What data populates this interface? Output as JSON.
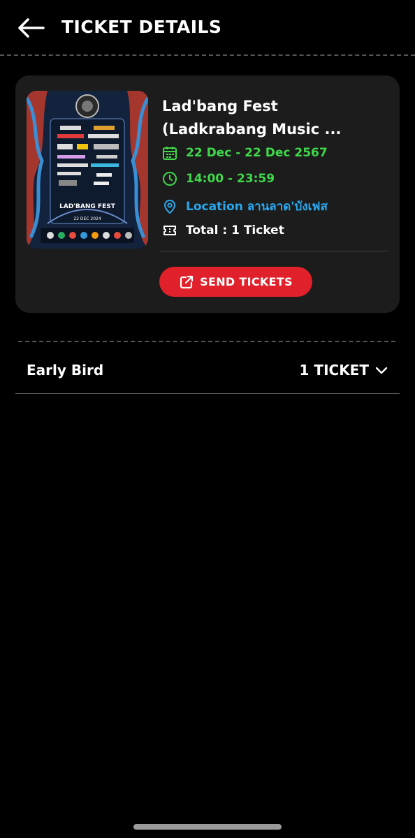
{
  "header": {
    "title": "TICKET DETAILS",
    "back_icon": "arrow-left-icon"
  },
  "event": {
    "title": "Lad'bang Fest (Ladkrabang Music ...",
    "date": "22 Dec - 22 Dec 2567",
    "time": "14:00 - 23:59",
    "location": "Location ลานลาด'บังเฟส",
    "total": "Total : 1 Ticket",
    "send_label": "SEND TICKETS",
    "icons": {
      "date": "calendar-icon",
      "time": "clock-icon",
      "location": "map-pin-icon",
      "total": "ticket-icon",
      "send": "external-link-icon"
    },
    "poster": {
      "festival_name": "LAD'BANG FEST",
      "festival_date": "22 DEC 2024"
    }
  },
  "ticket_types": [
    {
      "name": "Early Bird",
      "count": "1 TICKET"
    }
  ],
  "colors": {
    "background": "#000000",
    "card": "#1c1c1c",
    "accent_green": "#3fd94a",
    "accent_blue": "#29a8ee",
    "button_red": "#e0202a"
  }
}
